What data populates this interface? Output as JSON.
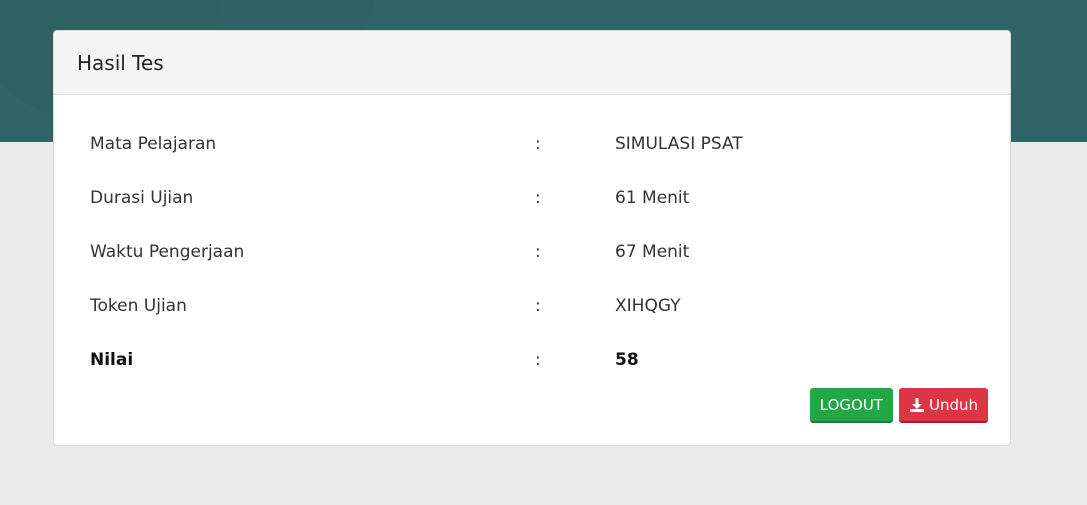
{
  "card": {
    "title": "Hasil Tes"
  },
  "rows": [
    {
      "label": "Mata Pelajaran",
      "colon": ":",
      "value": "SIMULASI PSAT"
    },
    {
      "label": "Durasi Ujian",
      "colon": ":",
      "value": "61 Menit"
    },
    {
      "label": "Waktu Pengerjaan",
      "colon": ":",
      "value": "67 Menit"
    },
    {
      "label": "Token Ujian",
      "colon": ":",
      "value": "XIHQGY"
    },
    {
      "label": "Nilai",
      "colon": ":",
      "value": "58"
    }
  ],
  "buttons": {
    "logout_label": "LOGOUT",
    "download_label": "Unduh",
    "download_icon": "download-icon"
  },
  "colors": {
    "banner": "#316565",
    "logout": "#22a745",
    "download": "#dc3545"
  }
}
